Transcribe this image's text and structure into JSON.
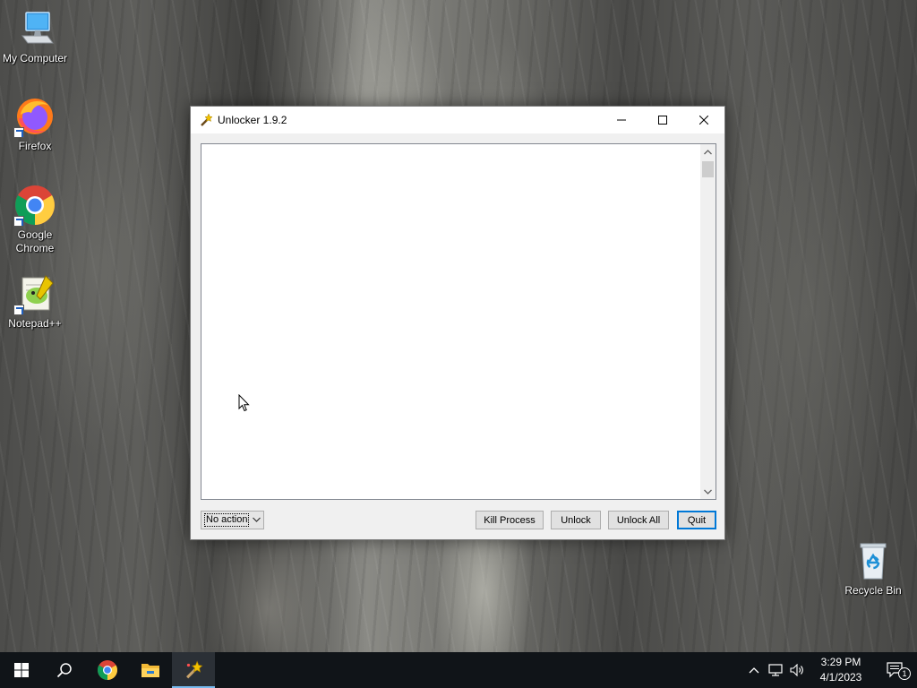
{
  "desktop": {
    "icons": [
      {
        "label": "My Computer",
        "icon": "computer-icon"
      },
      {
        "label": "Firefox",
        "icon": "firefox-icon"
      },
      {
        "label": "Google Chrome",
        "icon": "chrome-icon"
      },
      {
        "label": "Notepad++",
        "icon": "notepadpp-icon"
      },
      {
        "label": "Recycle Bin",
        "icon": "recycle-bin-icon"
      }
    ]
  },
  "window": {
    "title": "Unlocker 1.9.2",
    "icon": "unlocker-wand-icon",
    "controls": {
      "minimize": "minimize-icon",
      "maximize": "maximize-icon",
      "close": "close-icon"
    },
    "action_select": {
      "value": "No action"
    },
    "buttons": {
      "kill_process": "Kill Process",
      "unlock": "Unlock",
      "unlock_all": "Unlock All",
      "quit": "Quit"
    }
  },
  "taskbar": {
    "items": [
      "start-icon",
      "search-icon",
      "chrome-icon",
      "file-explorer-icon",
      "unlocker-icon"
    ],
    "tray": {
      "time": "3:29 PM",
      "date": "4/1/2023",
      "notification_count": "1"
    }
  },
  "colors": {
    "accent": "#0078d7",
    "taskbar": "#101418",
    "active_indicator": "#76b9ed"
  }
}
